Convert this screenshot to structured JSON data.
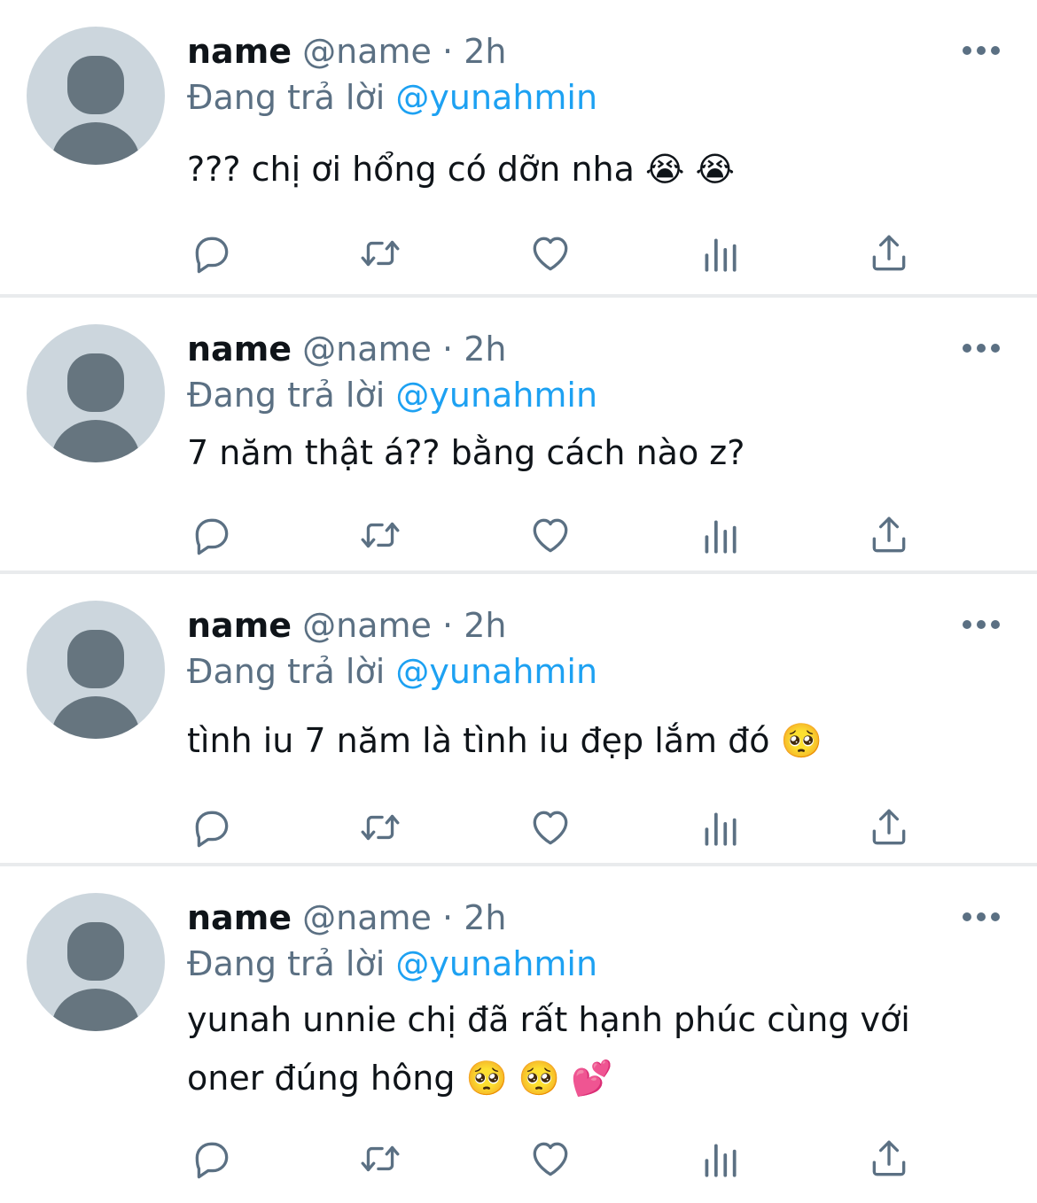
{
  "colors": {
    "accent": "#1da1f2",
    "secondary_text": "#5b7083",
    "primary_text": "#0f1419",
    "avatar_bg": "#ccd6dd",
    "avatar_fg": "#66757f",
    "divider": "#e9ebed"
  },
  "icons": {
    "more": "more-icon",
    "reply": "reply-icon",
    "retweet": "retweet-icon",
    "like": "heart-icon",
    "views": "views-icon",
    "share": "share-icon"
  },
  "tweets": [
    {
      "name": "name",
      "handle": "@name",
      "separator": "·",
      "time": "2h",
      "reply_prefix": "Đang trả lời",
      "reply_to": "@yunahmin",
      "text": "??? chị ơi hổng có dỡn nha 😭 😭"
    },
    {
      "name": "name",
      "handle": "@name",
      "separator": "·",
      "time": "2h",
      "reply_prefix": "Đang trả lời",
      "reply_to": "@yunahmin",
      "text": "7 năm thật á?? bằng cách nào z?"
    },
    {
      "name": "name",
      "handle": "@name",
      "separator": "·",
      "time": "2h",
      "reply_prefix": "Đang trả lời",
      "reply_to": "@yunahmin",
      "text": "tình iu 7 năm là tình iu đẹp lắm đó 🥺"
    },
    {
      "name": "name",
      "handle": "@name",
      "separator": "·",
      "time": "2h",
      "reply_prefix": "Đang trả lời",
      "reply_to": "@yunahmin",
      "text": "yunah unnie chị đã rất hạnh phúc cùng với oner đúng hông 🥺 🥺 💕"
    }
  ]
}
